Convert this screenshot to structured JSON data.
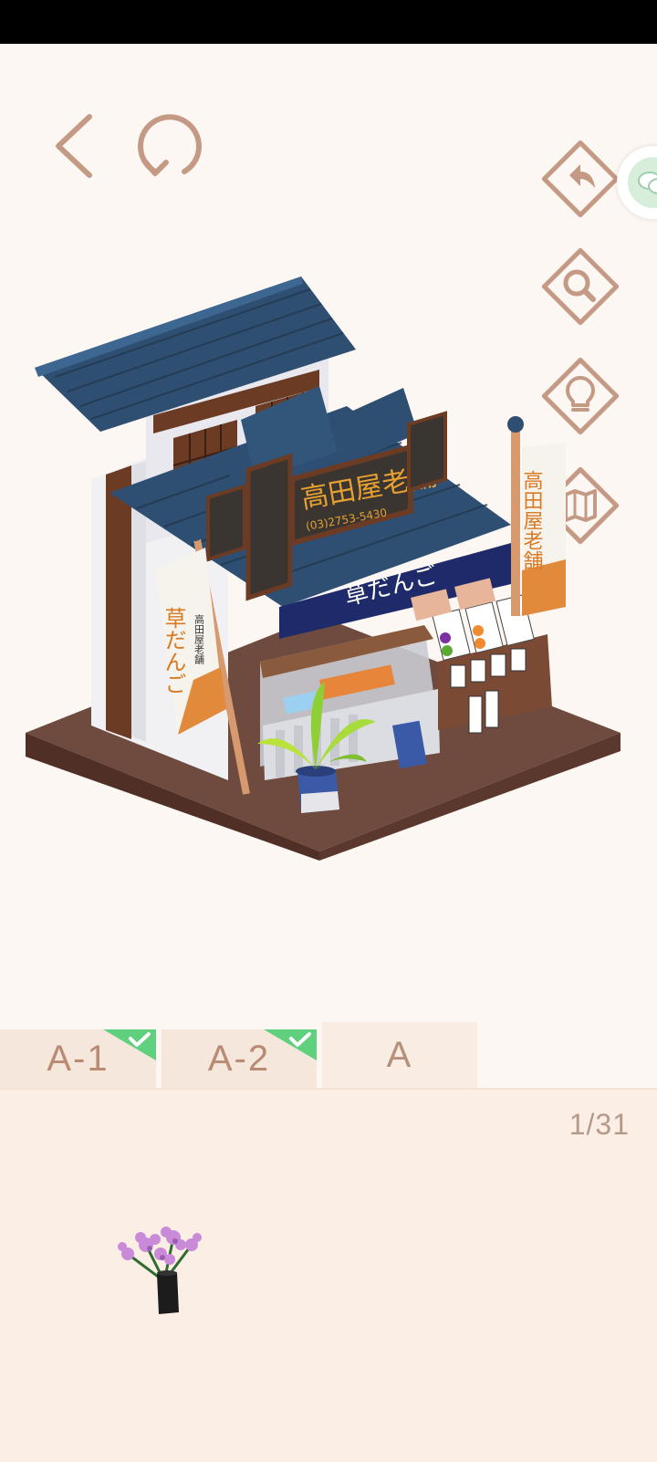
{
  "toolbar": {
    "back_icon": "chevron-left-icon",
    "restart_icon": "restart-icon"
  },
  "side_buttons": [
    {
      "name": "undo",
      "icon": "undo-icon"
    },
    {
      "name": "zoom",
      "icon": "magnifier-icon"
    },
    {
      "name": "hint",
      "icon": "lightbulb-icon"
    },
    {
      "name": "map",
      "icon": "map-icon"
    }
  ],
  "chat": {
    "icon": "chat-bubble-icon"
  },
  "scene": {
    "signs": {
      "roof_sign": "高田屋老舗",
      "roof_sign_phone": "(03)2753-5430",
      "curtain": "草だんご",
      "banner_left": "草だんご",
      "banner_left_small": "高田屋老舗",
      "banner_right": "高田屋老舗"
    }
  },
  "tabs": [
    {
      "label": "A-1",
      "completed": true
    },
    {
      "label": "A-2",
      "completed": true
    },
    {
      "label": "A",
      "completed": false
    }
  ],
  "tray": {
    "page_count": "1/31",
    "items": [
      {
        "name": "flower-vase",
        "icon": "flower-vase-icon"
      }
    ]
  },
  "colors": {
    "accent": "#c49a85",
    "check": "#5fd07e",
    "roof": "#2f4f72",
    "wood": "#6b3b24"
  }
}
